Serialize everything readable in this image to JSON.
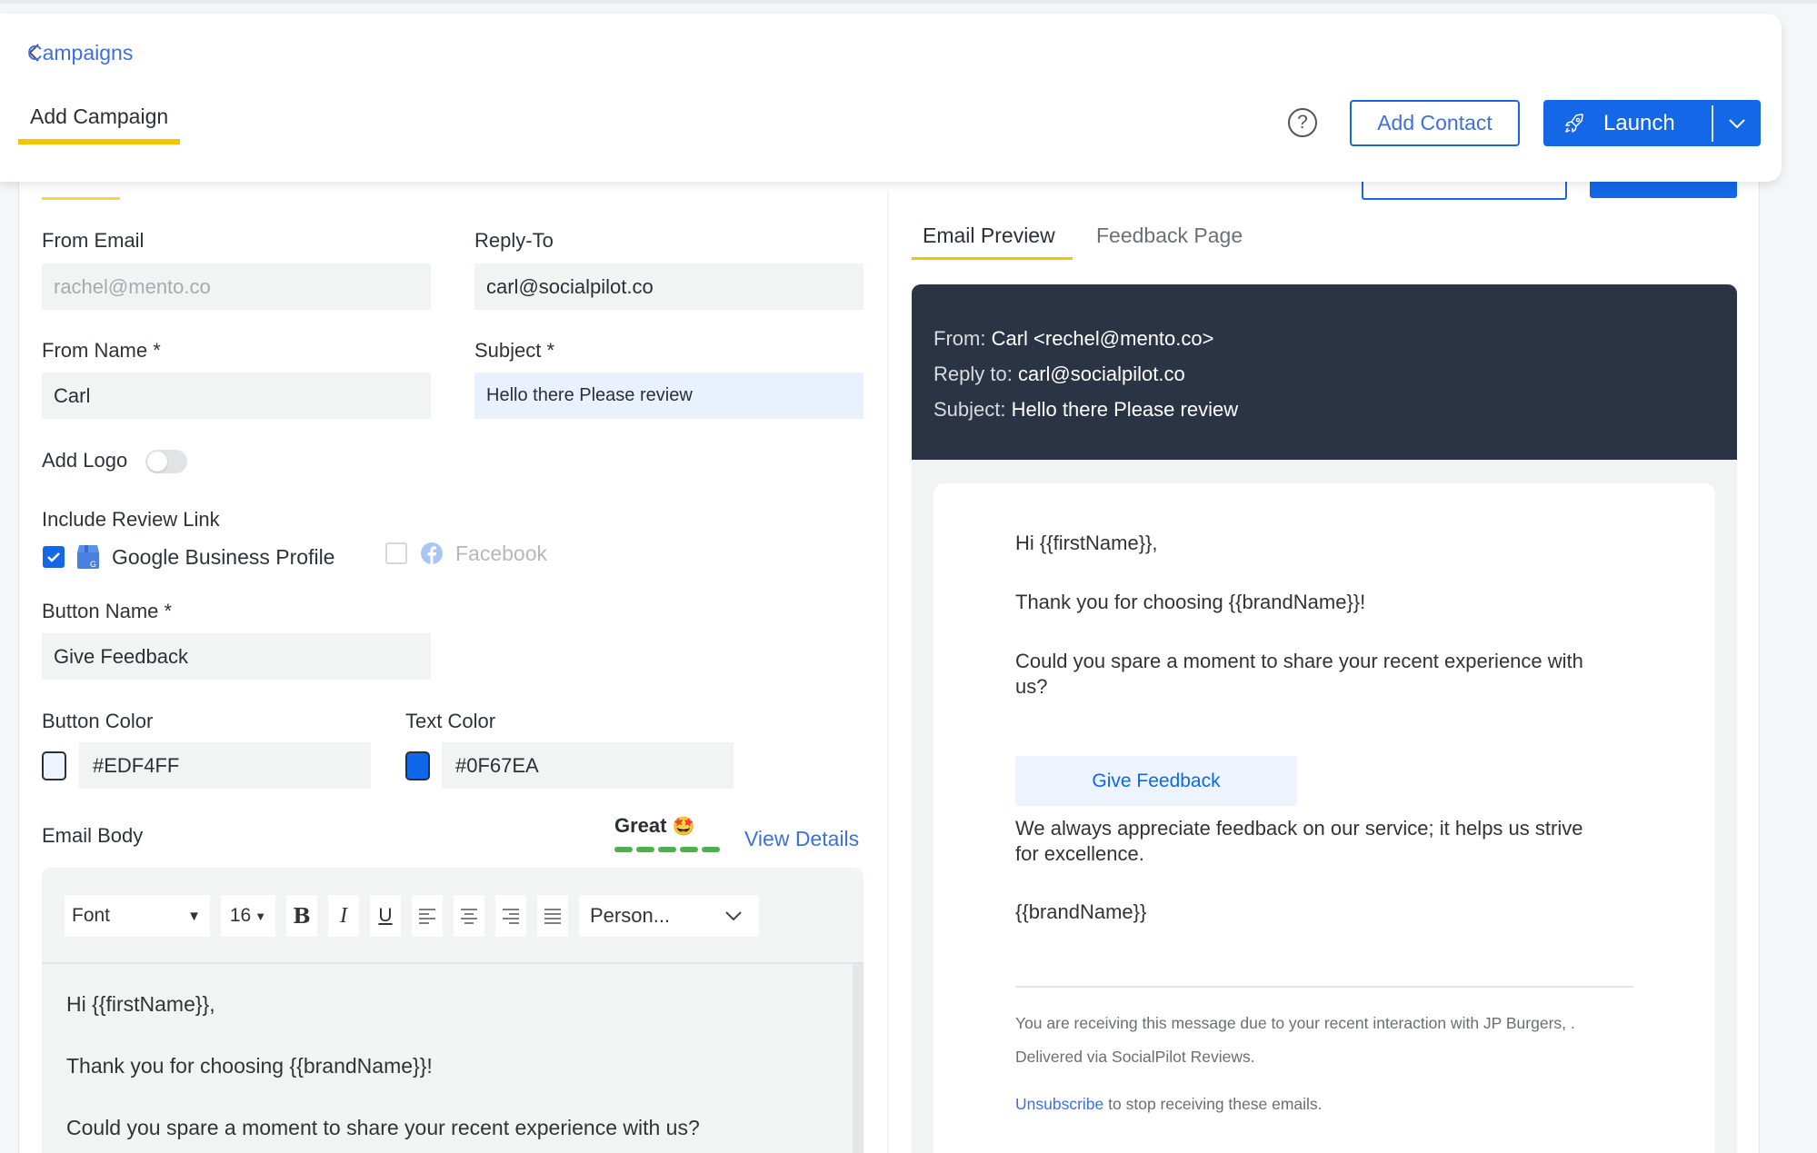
{
  "header": {
    "back_label": "Campaigns",
    "page_tab": "Add Campaign",
    "help_icon": "question-circle-icon",
    "add_contact": "Add Contact",
    "launch": "Launch",
    "launch_icon": "rocket-icon",
    "accent_color": "#1467E6",
    "tab_underline_color": "#F5C400"
  },
  "form": {
    "from_email": {
      "label": "From Email",
      "value": "rachel@mento.co",
      "disabled": true
    },
    "reply_to": {
      "label": "Reply-To",
      "value": "carl@socialpilot.co"
    },
    "from_name": {
      "label": "From Name *",
      "value": "Carl"
    },
    "subject": {
      "label": "Subject *",
      "value": "Hello there Please review"
    },
    "add_logo": {
      "label": "Add Logo",
      "enabled": false
    },
    "review_link": {
      "label": "Include Review Link",
      "options": [
        {
          "label": "Google Business Profile",
          "checked": true,
          "icon": "google-business-icon"
        },
        {
          "label": "Facebook",
          "checked": false,
          "icon": "facebook-icon"
        }
      ]
    },
    "button_name": {
      "label": "Button Name *",
      "value": "Give Feedback"
    },
    "button_color": {
      "label": "Button Color",
      "value": "#EDF4FF"
    },
    "text_color": {
      "label": "Text Color",
      "value": "#0F67EA"
    },
    "email_body": {
      "label": "Email Body",
      "score_label": "Great",
      "score_emoji": "🤩",
      "score_level": "5/5",
      "view_details": "View Details",
      "toolbar": {
        "font": "Font",
        "size": "16",
        "bold": "B",
        "italic": "I",
        "underline": "U",
        "personalize": "Person..."
      },
      "lines": [
        "Hi {{firstName}},",
        "Thank you for choosing {{brandName}}!",
        "Could you spare a moment to share your recent experience with us?"
      ]
    }
  },
  "preview": {
    "tabs": [
      {
        "label": "Email Preview",
        "active": true
      },
      {
        "label": "Feedback Page",
        "active": false
      }
    ],
    "from_key": "From:",
    "from_val": "Carl <rechel@mento.co>",
    "reply_key": "Reply to:",
    "reply_val": "carl@socialpilot.co",
    "subject_key": "Subject:",
    "subject_val": "Hello there Please review",
    "greeting": "Hi {{firstName}},",
    "thanks": "Thank you for choosing {{brandName}}!",
    "ask": "Could you spare a moment to share your recent experience with us?",
    "button": "Give Feedback",
    "appreciate": "We always appreciate feedback on our service; it helps us strive for excellence.",
    "signature": "{{brandName}}",
    "footer_1": "You are receiving this message due to your recent interaction with JP Burgers, .",
    "footer_2": "Delivered via SocialPilot Reviews.",
    "unsubscribe": "Unsubscribe",
    "unsubscribe_rest": " to stop receiving these emails."
  }
}
